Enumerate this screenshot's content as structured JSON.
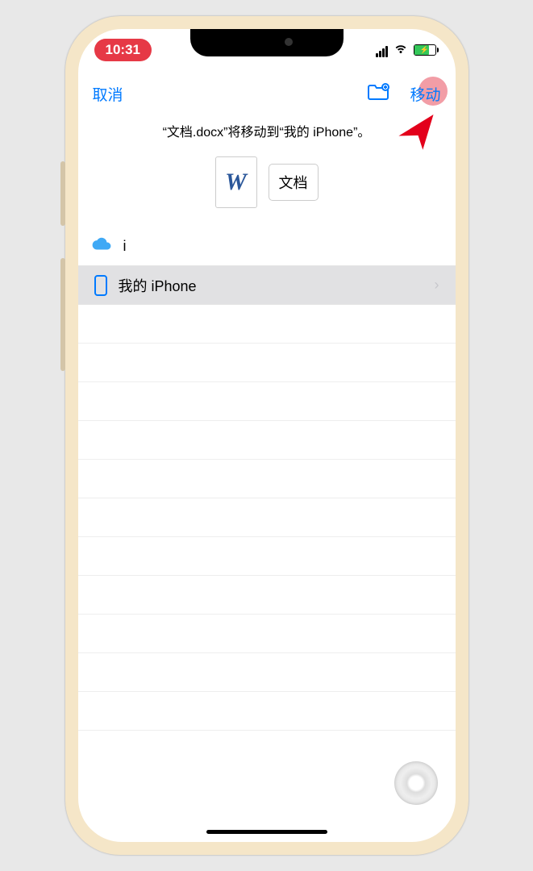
{
  "status": {
    "time": "10:31"
  },
  "navbar": {
    "cancel": "取消",
    "move": "移动"
  },
  "hint": "“文档.docx”将移动到“我的 iPhone”。",
  "file": {
    "glyph": "W",
    "name": "文档"
  },
  "locations": {
    "icloud_prefix": "i",
    "my_iphone": "我的 iPhone"
  }
}
